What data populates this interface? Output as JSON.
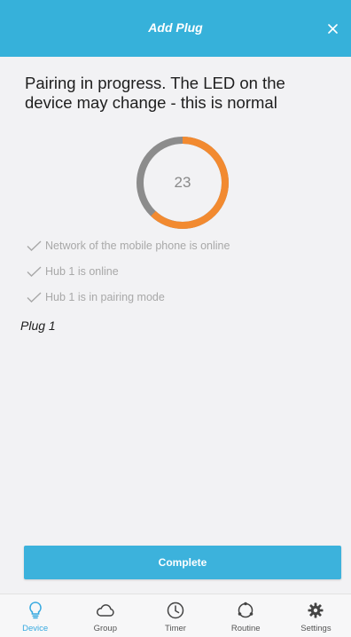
{
  "header": {
    "title": "Add Plug",
    "close_icon": "close-icon"
  },
  "colors": {
    "accent": "#36b1da",
    "progress_orange": "#f28a30",
    "progress_gray": "#8c8c8c",
    "active_tab": "#36a9e0"
  },
  "pairing": {
    "message": "Pairing in progress. The LED on the device may change - this is normal",
    "countdown": "23",
    "progress_fraction": 0.62,
    "checks": [
      {
        "label": "Network of the mobile phone is online",
        "icon": "checkmark-icon"
      },
      {
        "label": "Hub 1 is online",
        "icon": "checkmark-icon"
      },
      {
        "label": "Hub 1 is in pairing mode",
        "icon": "checkmark-icon"
      }
    ]
  },
  "device": {
    "name": "Plug 1"
  },
  "actions": {
    "complete_label": "Complete"
  },
  "tabbar": {
    "tabs": [
      {
        "label": "Device",
        "icon": "lightbulb-icon",
        "active": true
      },
      {
        "label": "Group",
        "icon": "cloud-icon",
        "active": false
      },
      {
        "label": "Timer",
        "icon": "clock-icon",
        "active": false
      },
      {
        "label": "Routine",
        "icon": "routine-icon",
        "active": false
      },
      {
        "label": "Settings",
        "icon": "gear-icon",
        "active": false
      }
    ]
  }
}
